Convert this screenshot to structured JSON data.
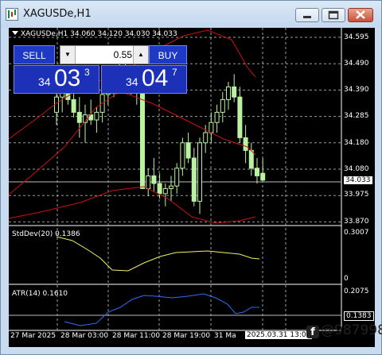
{
  "window": {
    "title": "XAGUSDe,H1",
    "icon": "chart-window-icon"
  },
  "chart": {
    "header": "XAGUSDe,H1  34.060 34.120 34.030 34.033",
    "symbol": "XAGUSDe",
    "timeframe": "H1",
    "ohlc": {
      "open": "34.060",
      "high": "34.120",
      "low": "34.030",
      "close": "34.033"
    },
    "colors": {
      "background": "#000000",
      "bull": "#b9f2a0",
      "bear": "#b9f2a0",
      "bands": "#cc1010",
      "grid": "#cfcfcf",
      "stddev": "#f2f060",
      "atr": "#2f6cf5"
    },
    "price_axis": [
      "34.595",
      "34.490",
      "34.390",
      "34.285",
      "34.180",
      "34.080",
      "33.975",
      "33.870"
    ],
    "current_price": "34.033",
    "time_axis": [
      "27 Mar 2025",
      "28 Mar 03:00",
      "28 Mar 11:00",
      "28 Mar 19:00",
      "31 Ma"
    ],
    "time_highlight": "2025.03.31 13:00"
  },
  "trade_panel": {
    "sell_label": "SELL",
    "buy_label": "BUY",
    "lot_value": "0.55",
    "sell": {
      "prefix": "34",
      "big": "03",
      "sup": "3"
    },
    "buy": {
      "prefix": "34",
      "big": "04",
      "sup": "7"
    }
  },
  "stddev": {
    "label": "StdDev(20) 0.1386",
    "axis_top": "0.3007",
    "axis_bottom": "0"
  },
  "atr": {
    "label": "ATR(14) 0.1610",
    "axis_top": "0.2075",
    "current": "0.1383"
  },
  "watermark": {
    "handle": "@987998"
  }
}
